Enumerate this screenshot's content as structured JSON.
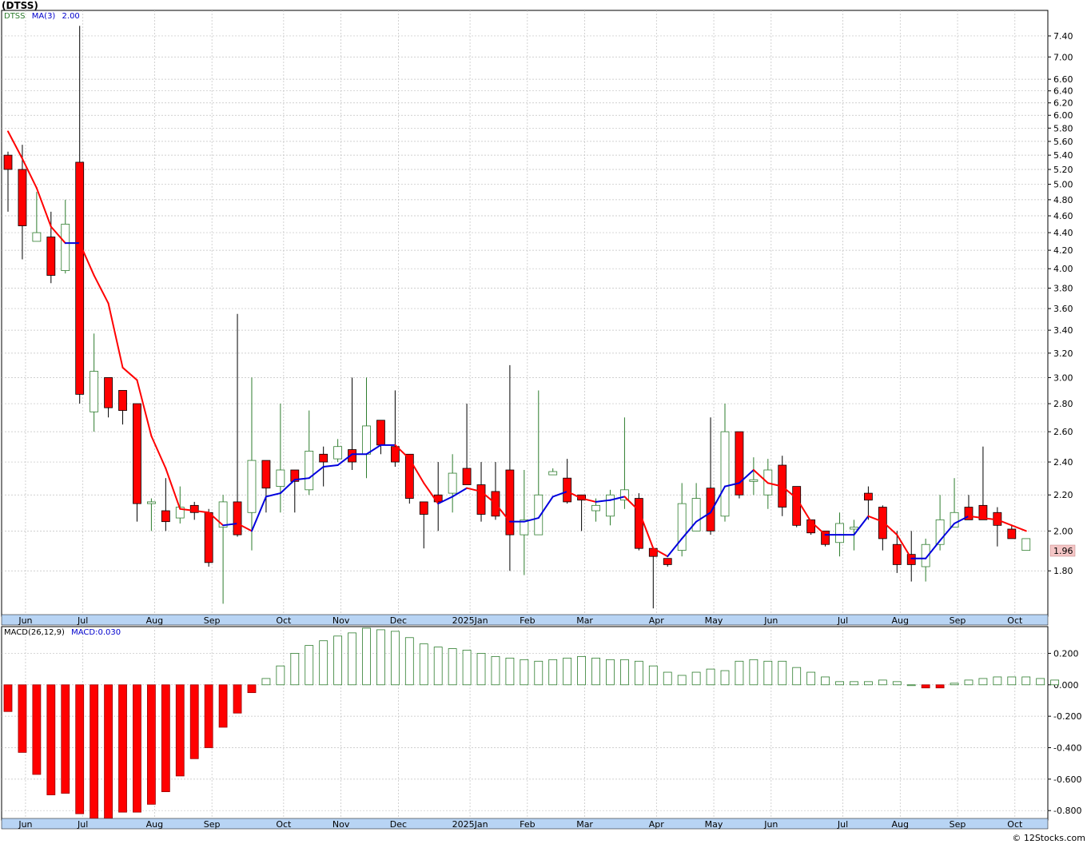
{
  "title": "(DTSS)",
  "legend": {
    "ticker": "DTSS",
    "ma_label": "MA(3)",
    "ma_value": "2.00",
    "macd_label": "MACD(26,12,9)",
    "macd_value": "MACD:0.030"
  },
  "last_price_label": "1.96",
  "credit": "© 12Stocks.com",
  "colors": {
    "up_candle": "#2e7d2e",
    "down_candle": "#ff0000",
    "ma_up": "#0000dd",
    "ma_down": "#ff0000",
    "axis_band": "#b8d4f4",
    "grid": "#c0c0c0"
  },
  "chart_data": [
    {
      "type": "candlestick",
      "title": "(DTSS)",
      "y_ticks": [
        "1.80",
        "2.00",
        "2.20",
        "2.40",
        "2.60",
        "2.80",
        "3.00",
        "3.20",
        "3.40",
        "3.60",
        "3.80",
        "4.00",
        "4.20",
        "4.40",
        "4.60",
        "4.80",
        "5.00",
        "5.20",
        "5.40",
        "5.60",
        "5.80",
        "6.00",
        "6.20",
        "6.40",
        "6.60",
        "7.00",
        "7.40"
      ],
      "y_scale": "log",
      "ylim": [
        1.6,
        7.9
      ],
      "x_tick_labels": [
        "Jun",
        "Jul",
        "Aug",
        "Sep",
        "Oct",
        "Nov",
        "Dec",
        "2025Jan",
        "Feb",
        "Mar",
        "Apr",
        "May",
        "Jun",
        "Jul",
        "Aug",
        "Sep",
        "Oct"
      ],
      "x_tick_weeks": [
        1,
        5,
        10,
        14,
        19,
        23,
        27,
        32,
        36,
        40,
        45,
        49,
        53,
        58,
        62,
        66,
        70
      ],
      "grid": true,
      "series": [
        {
          "name": "DTSS",
          "weeks": [
            {
              "o": 5.4,
              "h": 5.45,
              "l": 4.65,
              "c": 5.2
            },
            {
              "o": 5.2,
              "h": 5.55,
              "l": 4.1,
              "c": 4.48
            },
            {
              "o": 4.3,
              "h": 4.9,
              "l": 4.3,
              "c": 4.4
            },
            {
              "o": 4.35,
              "h": 4.65,
              "l": 3.85,
              "c": 3.93
            },
            {
              "o": 3.98,
              "h": 4.8,
              "l": 3.95,
              "c": 4.5
            },
            {
              "o": 5.3,
              "h": 7.6,
              "l": 2.8,
              "c": 2.87
            },
            {
              "o": 2.74,
              "h": 3.37,
              "l": 2.6,
              "c": 3.05
            },
            {
              "o": 3.0,
              "h": 3.0,
              "l": 2.7,
              "c": 2.77
            },
            {
              "o": 2.9,
              "h": 2.9,
              "l": 2.65,
              "c": 2.75
            },
            {
              "o": 2.8,
              "h": 2.8,
              "l": 2.05,
              "c": 2.15
            },
            {
              "o": 2.15,
              "h": 2.18,
              "l": 2.0,
              "c": 2.16
            },
            {
              "o": 2.11,
              "h": 2.3,
              "l": 2.0,
              "c": 2.05
            },
            {
              "o": 2.07,
              "h": 2.25,
              "l": 2.04,
              "c": 2.13
            },
            {
              "o": 2.14,
              "h": 2.16,
              "l": 2.06,
              "c": 2.1
            },
            {
              "o": 2.1,
              "h": 2.12,
              "l": 1.82,
              "c": 1.84
            },
            {
              "o": 2.02,
              "h": 2.2,
              "l": 1.65,
              "c": 2.16
            },
            {
              "o": 2.16,
              "h": 3.55,
              "l": 1.97,
              "c": 1.98
            },
            {
              "o": 2.1,
              "h": 3.0,
              "l": 1.9,
              "c": 2.41
            },
            {
              "o": 2.41,
              "h": 2.41,
              "l": 2.1,
              "c": 2.24
            },
            {
              "o": 2.25,
              "h": 2.8,
              "l": 2.1,
              "c": 2.35
            },
            {
              "o": 2.35,
              "h": 2.35,
              "l": 2.1,
              "c": 2.28
            },
            {
              "o": 2.23,
              "h": 2.75,
              "l": 2.2,
              "c": 2.47
            },
            {
              "o": 2.45,
              "h": 2.5,
              "l": 2.25,
              "c": 2.4
            },
            {
              "o": 2.42,
              "h": 2.55,
              "l": 2.4,
              "c": 2.5
            },
            {
              "o": 2.48,
              "h": 3.0,
              "l": 2.35,
              "c": 2.4
            },
            {
              "o": 2.45,
              "h": 3.0,
              "l": 2.3,
              "c": 2.64
            },
            {
              "o": 2.68,
              "h": 2.68,
              "l": 2.45,
              "c": 2.51
            },
            {
              "o": 2.5,
              "h": 2.9,
              "l": 2.37,
              "c": 2.4
            },
            {
              "o": 2.45,
              "h": 2.45,
              "l": 2.15,
              "c": 2.18
            },
            {
              "o": 2.16,
              "h": 2.16,
              "l": 1.91,
              "c": 2.09
            },
            {
              "o": 2.2,
              "h": 2.4,
              "l": 2.0,
              "c": 2.16
            },
            {
              "o": 2.21,
              "h": 2.45,
              "l": 2.1,
              "c": 2.33
            },
            {
              "o": 2.36,
              "h": 2.8,
              "l": 2.26,
              "c": 2.26
            },
            {
              "o": 2.26,
              "h": 2.4,
              "l": 2.05,
              "c": 2.09
            },
            {
              "o": 2.22,
              "h": 2.4,
              "l": 2.06,
              "c": 2.08
            },
            {
              "o": 2.35,
              "h": 3.1,
              "l": 1.8,
              "c": 1.98
            },
            {
              "o": 1.98,
              "h": 2.35,
              "l": 1.78,
              "c": 2.06
            },
            {
              "o": 1.98,
              "h": 2.9,
              "l": 1.98,
              "c": 2.2
            },
            {
              "o": 2.32,
              "h": 2.36,
              "l": 2.32,
              "c": 2.34
            },
            {
              "o": 2.3,
              "h": 2.42,
              "l": 2.15,
              "c": 2.16
            },
            {
              "o": 2.2,
              "h": 2.2,
              "l": 2.0,
              "c": 2.17
            },
            {
              "o": 2.11,
              "h": 2.18,
              "l": 2.05,
              "c": 2.14
            },
            {
              "o": 2.08,
              "h": 2.23,
              "l": 2.03,
              "c": 2.2
            },
            {
              "o": 2.17,
              "h": 2.7,
              "l": 2.12,
              "c": 2.23
            },
            {
              "o": 2.18,
              "h": 2.21,
              "l": 1.9,
              "c": 1.91
            },
            {
              "o": 1.91,
              "h": 1.91,
              "l": 1.63,
              "c": 1.87
            },
            {
              "o": 1.86,
              "h": 1.86,
              "l": 1.82,
              "c": 1.83
            },
            {
              "o": 1.9,
              "h": 2.27,
              "l": 1.87,
              "c": 2.15
            },
            {
              "o": 2.0,
              "h": 2.27,
              "l": 2.0,
              "c": 2.18
            },
            {
              "o": 2.24,
              "h": 2.7,
              "l": 1.98,
              "c": 2.0
            },
            {
              "o": 2.08,
              "h": 2.8,
              "l": 2.05,
              "c": 2.6
            },
            {
              "o": 2.6,
              "h": 2.6,
              "l": 2.18,
              "c": 2.2
            },
            {
              "o": 2.28,
              "h": 2.43,
              "l": 2.2,
              "c": 2.29
            },
            {
              "o": 2.2,
              "h": 2.42,
              "l": 2.12,
              "c": 2.35
            },
            {
              "o": 2.38,
              "h": 2.44,
              "l": 2.08,
              "c": 2.13
            },
            {
              "o": 2.25,
              "h": 2.25,
              "l": 2.02,
              "c": 2.03
            },
            {
              "o": 2.06,
              "h": 2.06,
              "l": 1.98,
              "c": 1.99
            },
            {
              "o": 2.0,
              "h": 2.0,
              "l": 1.92,
              "c": 1.93
            },
            {
              "o": 1.94,
              "h": 2.1,
              "l": 1.87,
              "c": 2.04
            },
            {
              "o": 2.01,
              "h": 2.06,
              "l": 1.9,
              "c": 2.02
            },
            {
              "o": 2.21,
              "h": 2.25,
              "l": 2.06,
              "c": 2.17
            },
            {
              "o": 2.13,
              "h": 2.14,
              "l": 1.9,
              "c": 1.96
            },
            {
              "o": 1.93,
              "h": 2.0,
              "l": 1.79,
              "c": 1.83
            },
            {
              "o": 1.88,
              "h": 2.0,
              "l": 1.75,
              "c": 1.83
            },
            {
              "o": 1.82,
              "h": 1.96,
              "l": 1.75,
              "c": 1.93
            },
            {
              "o": 1.93,
              "h": 2.2,
              "l": 1.9,
              "c": 2.06
            },
            {
              "o": 2.02,
              "h": 2.3,
              "l": 2.02,
              "c": 2.1
            },
            {
              "o": 2.13,
              "h": 2.2,
              "l": 2.07,
              "c": 2.06
            },
            {
              "o": 2.14,
              "h": 2.5,
              "l": 2.06,
              "c": 2.06
            },
            {
              "o": 2.1,
              "h": 2.13,
              "l": 1.92,
              "c": 2.03
            },
            {
              "o": 2.01,
              "h": 2.03,
              "l": 1.96,
              "c": 1.96
            },
            {
              "o": 1.9,
              "h": 1.96,
              "l": 1.9,
              "c": 1.96
            }
          ]
        },
        {
          "name": "MA(3)",
          "values": [
            5.75,
            5.35,
            4.95,
            4.47,
            4.28,
            4.28,
            3.93,
            3.65,
            3.08,
            2.98,
            2.57,
            2.36,
            2.12,
            2.11,
            2.1,
            2.03,
            2.04,
            2.0,
            2.19,
            2.21,
            2.29,
            2.3,
            2.37,
            2.38,
            2.45,
            2.45,
            2.51,
            2.51,
            2.42,
            2.27,
            2.15,
            2.19,
            2.24,
            2.22,
            2.15,
            2.05,
            2.05,
            2.07,
            2.19,
            2.22,
            2.18,
            2.16,
            2.17,
            2.19,
            2.11,
            1.91,
            1.87,
            1.96,
            2.05,
            2.1,
            2.25,
            2.27,
            2.35,
            2.27,
            2.25,
            2.18,
            2.05,
            1.98,
            1.98,
            1.98,
            2.08,
            2.05,
            1.98,
            1.86,
            1.86,
            1.95,
            2.04,
            2.08,
            2.07,
            2.06,
            2.03,
            2.0
          ]
        }
      ]
    },
    {
      "type": "bar",
      "title": "MACD(26,12,9)",
      "y_ticks": [
        "0.200",
        "0.000",
        "-0.200",
        "-0.400",
        "-0.600",
        "-0.800"
      ],
      "ylim": [
        -0.86,
        0.37
      ],
      "x_tick_labels": [
        "Jun",
        "Jul",
        "Aug",
        "Sep",
        "Oct",
        "Nov",
        "Dec",
        "2025Jan",
        "Feb",
        "Mar",
        "Apr",
        "May",
        "Jun",
        "Jul",
        "Aug",
        "Sep",
        "Oct"
      ],
      "grid": true,
      "series": [
        {
          "name": "MACD",
          "values": [
            -0.17,
            -0.43,
            -0.57,
            -0.7,
            -0.69,
            -0.82,
            -0.9,
            -0.88,
            -0.81,
            -0.81,
            -0.76,
            -0.68,
            -0.58,
            -0.47,
            -0.4,
            -0.27,
            -0.18,
            -0.05,
            0.04,
            0.12,
            0.2,
            0.25,
            0.28,
            0.31,
            0.33,
            0.36,
            0.35,
            0.34,
            0.3,
            0.26,
            0.24,
            0.23,
            0.22,
            0.2,
            0.18,
            0.17,
            0.16,
            0.15,
            0.16,
            0.17,
            0.18,
            0.17,
            0.16,
            0.16,
            0.15,
            0.12,
            0.08,
            0.06,
            0.08,
            0.1,
            0.09,
            0.15,
            0.16,
            0.15,
            0.15,
            0.11,
            0.08,
            0.05,
            0.02,
            0.02,
            0.02,
            0.03,
            0.02,
            0.0,
            -0.02,
            -0.02,
            0.01,
            0.03,
            0.04,
            0.05,
            0.05,
            0.05,
            0.04,
            0.03
          ]
        }
      ]
    }
  ]
}
